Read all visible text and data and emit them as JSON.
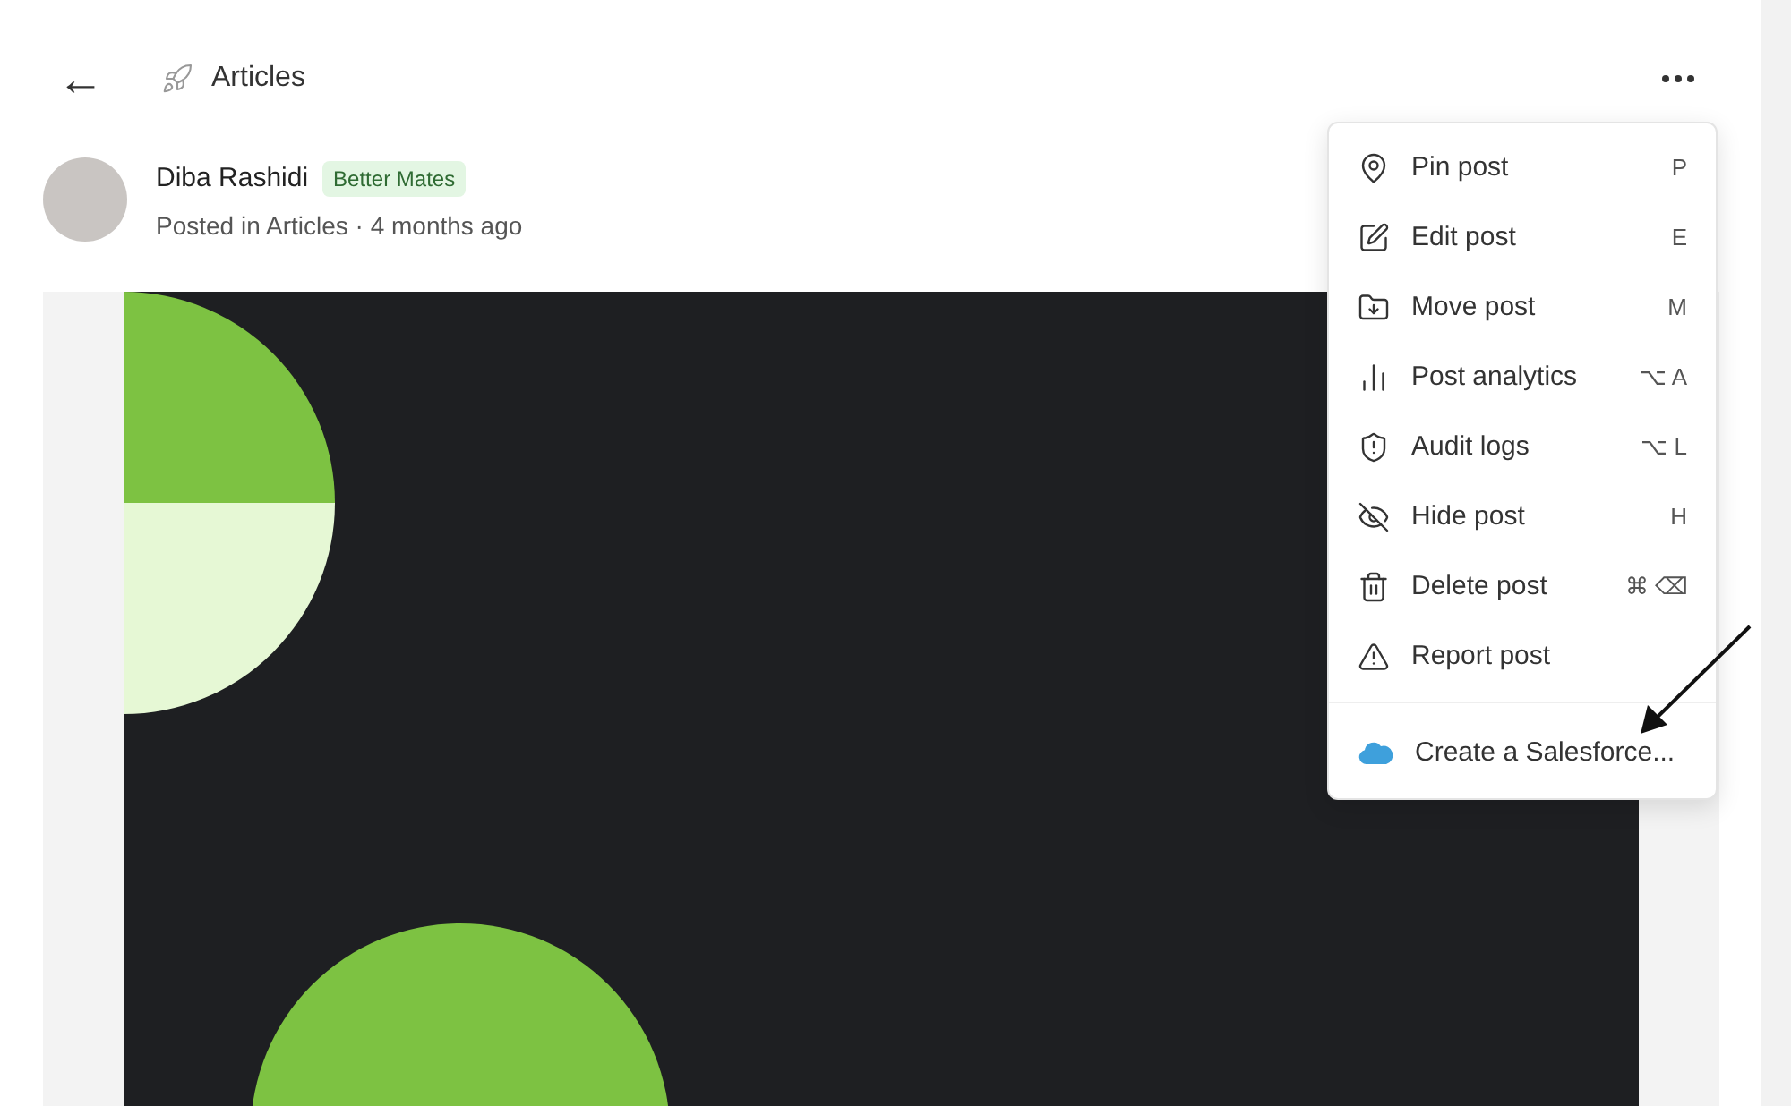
{
  "header": {
    "back": "←",
    "title": "Articles"
  },
  "post": {
    "author": "Diba Rashidi",
    "badge": "Better Mates",
    "meta": "Posted in Articles · 4 months ago"
  },
  "menu": {
    "items": [
      {
        "label": "Pin post",
        "shortcut": "P"
      },
      {
        "label": "Edit post",
        "shortcut": "E"
      },
      {
        "label": "Move post",
        "shortcut": "M"
      },
      {
        "label": "Post analytics",
        "shortcut": "⌥ A"
      },
      {
        "label": "Audit logs",
        "shortcut": "⌥ L"
      },
      {
        "label": "Hide post",
        "shortcut": "H"
      },
      {
        "label": "Delete post",
        "shortcut": "⌘ ⌫"
      },
      {
        "label": "Report post"
      }
    ],
    "integrations": [
      {
        "label": "Create a Salesforce..."
      }
    ]
  }
}
